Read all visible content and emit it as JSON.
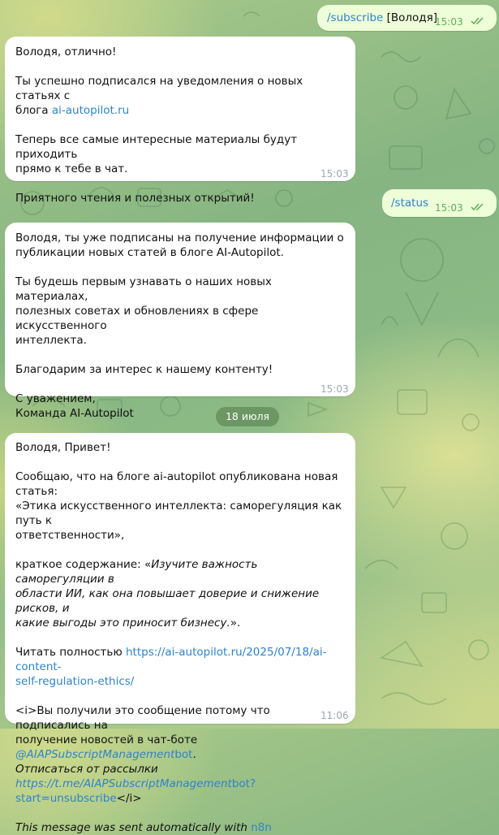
{
  "messages": {
    "m1": {
      "cmd": "/subscribe",
      "arg": " [Володя]",
      "time": "15:03"
    },
    "m2": {
      "line1": "Володя, отлично!",
      "line2_pre": "Ты успешно подписался на уведомления о новых статьях с",
      "line3_pre": "блога ",
      "link": "ai-autopilot.ru",
      "line4": "Теперь все самые интересные материалы будут приходить",
      "line5": "прямо к тебе в чат.",
      "line6": "Приятного чтения и полезных открытий!",
      "time": "15:03"
    },
    "m3": {
      "cmd": "/status",
      "time": "15:03"
    },
    "m4": {
      "l1": "Володя, ты уже подписаны на получение информации о",
      "l2": "публикации новых статей в блоге AI-Autopilot.",
      "l3": "Ты будешь первым узнавать о наших новых материалах,",
      "l4": "полезных советах и обновлениях в сфере искусственного",
      "l5": "интеллекта.",
      "l6": "Благодарим за интерес к нашему контенту!",
      "l7": "С уважением,",
      "l8": "Команда AI-Autopilot",
      "time": "15:03"
    },
    "date_separator": "18 июля",
    "m5": {
      "l1": "Володя, Привет!",
      "l2": "Сообщаю, что на блоге ai-autopilot опубликована новая статья:",
      "l3": "«Этика искусственного интеллекта: саморегуляция как путь к",
      "l4": "ответственности»,",
      "l5_pre": "краткое содержание: «",
      "l5_em": "Изучите важность саморегуляции в",
      "l6": "области ИИ, как она повышает доверие и снижение рисков, и",
      "l7": "какие выгоды это приносит бизнесу.",
      "l7_post": "».",
      "l8_pre": "Читать полностью ",
      "l8_link": "https://ai-autopilot.ru/2025/07/18/ai-content-",
      "l9_link": "self-regulation-ethics/",
      "l10": "<i>Вы получили это сообщение потому что подписались на",
      "l11_pre": "получение новостей в чат-боте ",
      "l11_link_em": "@AIAPSubscriptManagement",
      "l11_link": "bot",
      "l11_post": ".",
      "l12": "Отписаться от рассылки",
      "l13_link_em": "https://t.me/AIAPSubscriptManagement",
      "l13_link": "bot?start=unsubscribe",
      "l13_post": "</i>",
      "l14_em": "This message was sent automatically with ",
      "l14_link": "n8n",
      "time": "11:06"
    }
  },
  "colors": {
    "link": "#2f83c9",
    "outgoing_bubble": "#eefed9",
    "incoming_bubble": "#ffffff",
    "check": "#5fae55"
  }
}
